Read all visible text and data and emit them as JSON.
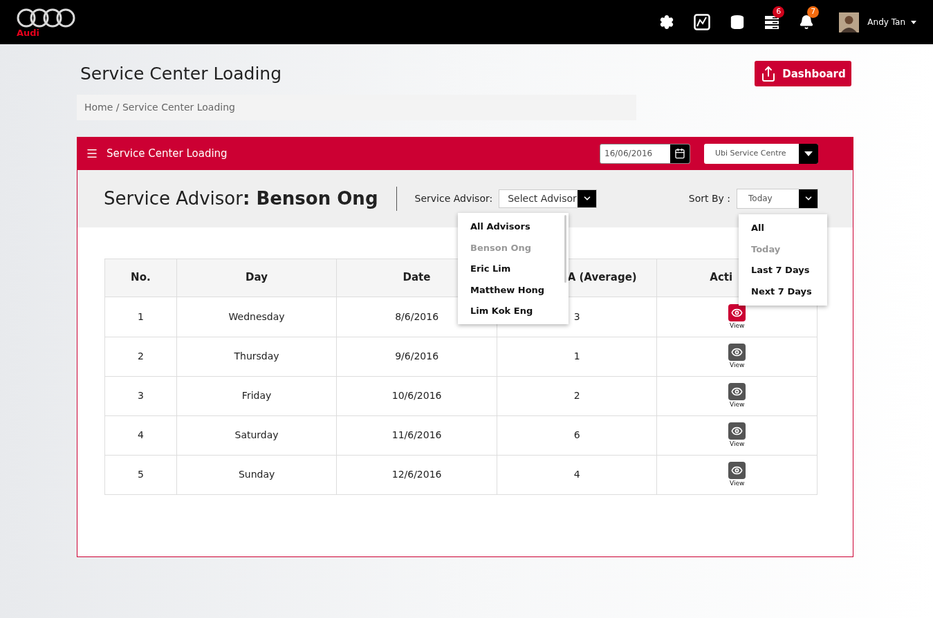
{
  "topbar": {
    "brand": "Audi",
    "badges": [
      {
        "kind": "server",
        "count": "6",
        "color": "#d0021b"
      },
      {
        "kind": "bell",
        "count": "7",
        "color": "#f26b0f"
      }
    ],
    "user": "Andy Tan"
  },
  "page": {
    "title": "Service Center Loading",
    "dashboard_button": "Dashboard",
    "breadcrumb": "Home / Service Center Loading"
  },
  "panel": {
    "title": "Service Center Loading",
    "date": "16/06/2016",
    "centre": "Ubi Service Centre"
  },
  "advisor": {
    "heading": "Service Advisor**: Benson Ong**",
    "select_label": "Service Advisor:",
    "select_value": "Select Advisor",
    "sort_label": "Sort By :",
    "sort_value": "Today"
  },
  "advisor_menu": [
    {
      "label": "All Advisors",
      "selected": false
    },
    {
      "label": "Benson Ong",
      "selected": true
    },
    {
      "label": "Eric Lim",
      "selected": false
    },
    {
      "label": "Matthew Hong",
      "selected": false
    },
    {
      "label": "Lim Kok Eng",
      "selected": false
    }
  ],
  "sort_menu": [
    {
      "label": "All",
      "selected": false
    },
    {
      "label": "Today",
      "selected": true
    },
    {
      "label": "Last 7 Days",
      "selected": false
    },
    {
      "label": "Next 7 Days",
      "selected": false
    }
  ],
  "table": {
    "columns": [
      "No.",
      "Day",
      "Date",
      "A (Average)",
      "Acti"
    ],
    "rows": [
      {
        "cells": [
          "1",
          "Wednesday",
          "8/6/2016",
          "3"
        ],
        "action": "View",
        "selected": true
      },
      {
        "cells": [
          "2",
          "Thursday",
          "9/6/2016",
          "1"
        ],
        "action": "View",
        "selected": false
      },
      {
        "cells": [
          "3",
          "Friday",
          "10/6/2016",
          "2"
        ],
        "action": "View",
        "selected": false
      },
      {
        "cells": [
          "4",
          "Saturday",
          "11/6/2016",
          "6"
        ],
        "action": "View",
        "selected": false
      },
      {
        "cells": [
          "5",
          "Sunday",
          "12/6/2016",
          "4"
        ],
        "action": "View",
        "selected": false
      }
    ]
  }
}
